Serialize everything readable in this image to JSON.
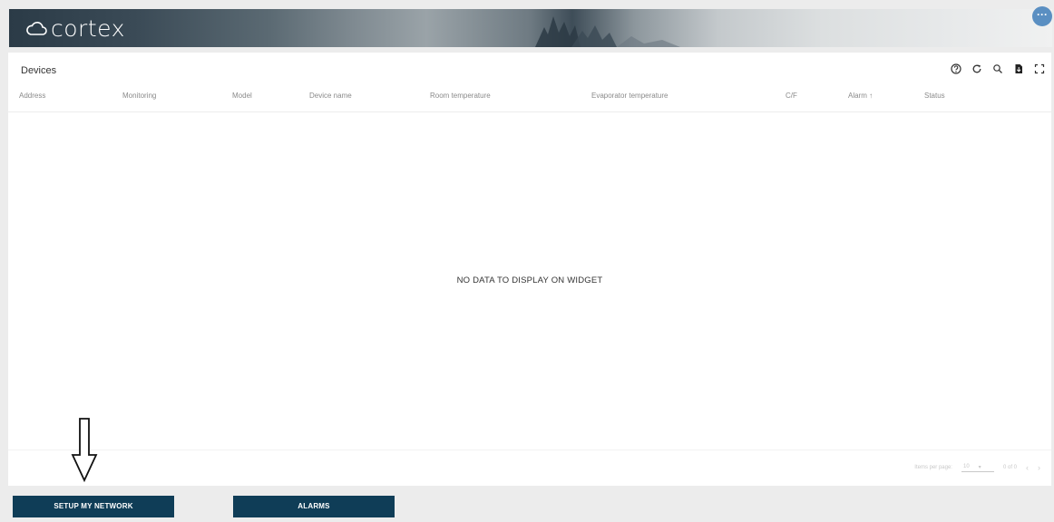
{
  "header": {
    "logo_text": "cortex",
    "logo_icon": "cloud-icon",
    "menu_glyph": "···"
  },
  "widget": {
    "title": "Devices",
    "tools": [
      "help-icon",
      "refresh-icon",
      "search-icon",
      "export-icon",
      "fullscreen-icon"
    ],
    "columns": [
      "Address",
      "Monitoring",
      "Model",
      "Device name",
      "Room temperature",
      "Evaporator temperature",
      "C/F",
      "Alarm ↑",
      "Status"
    ],
    "empty_message": "NO DATA TO DISPLAY ON WIDGET",
    "pagination": {
      "items_label": "Items per page:",
      "page_size": "10",
      "range": "0 of 0"
    }
  },
  "buttons": {
    "setup": "SETUP MY NETWORK",
    "alarms": "ALARMS"
  },
  "colors": {
    "button_bg": "#0f3d57",
    "menu_dot": "#5a8fc2"
  }
}
